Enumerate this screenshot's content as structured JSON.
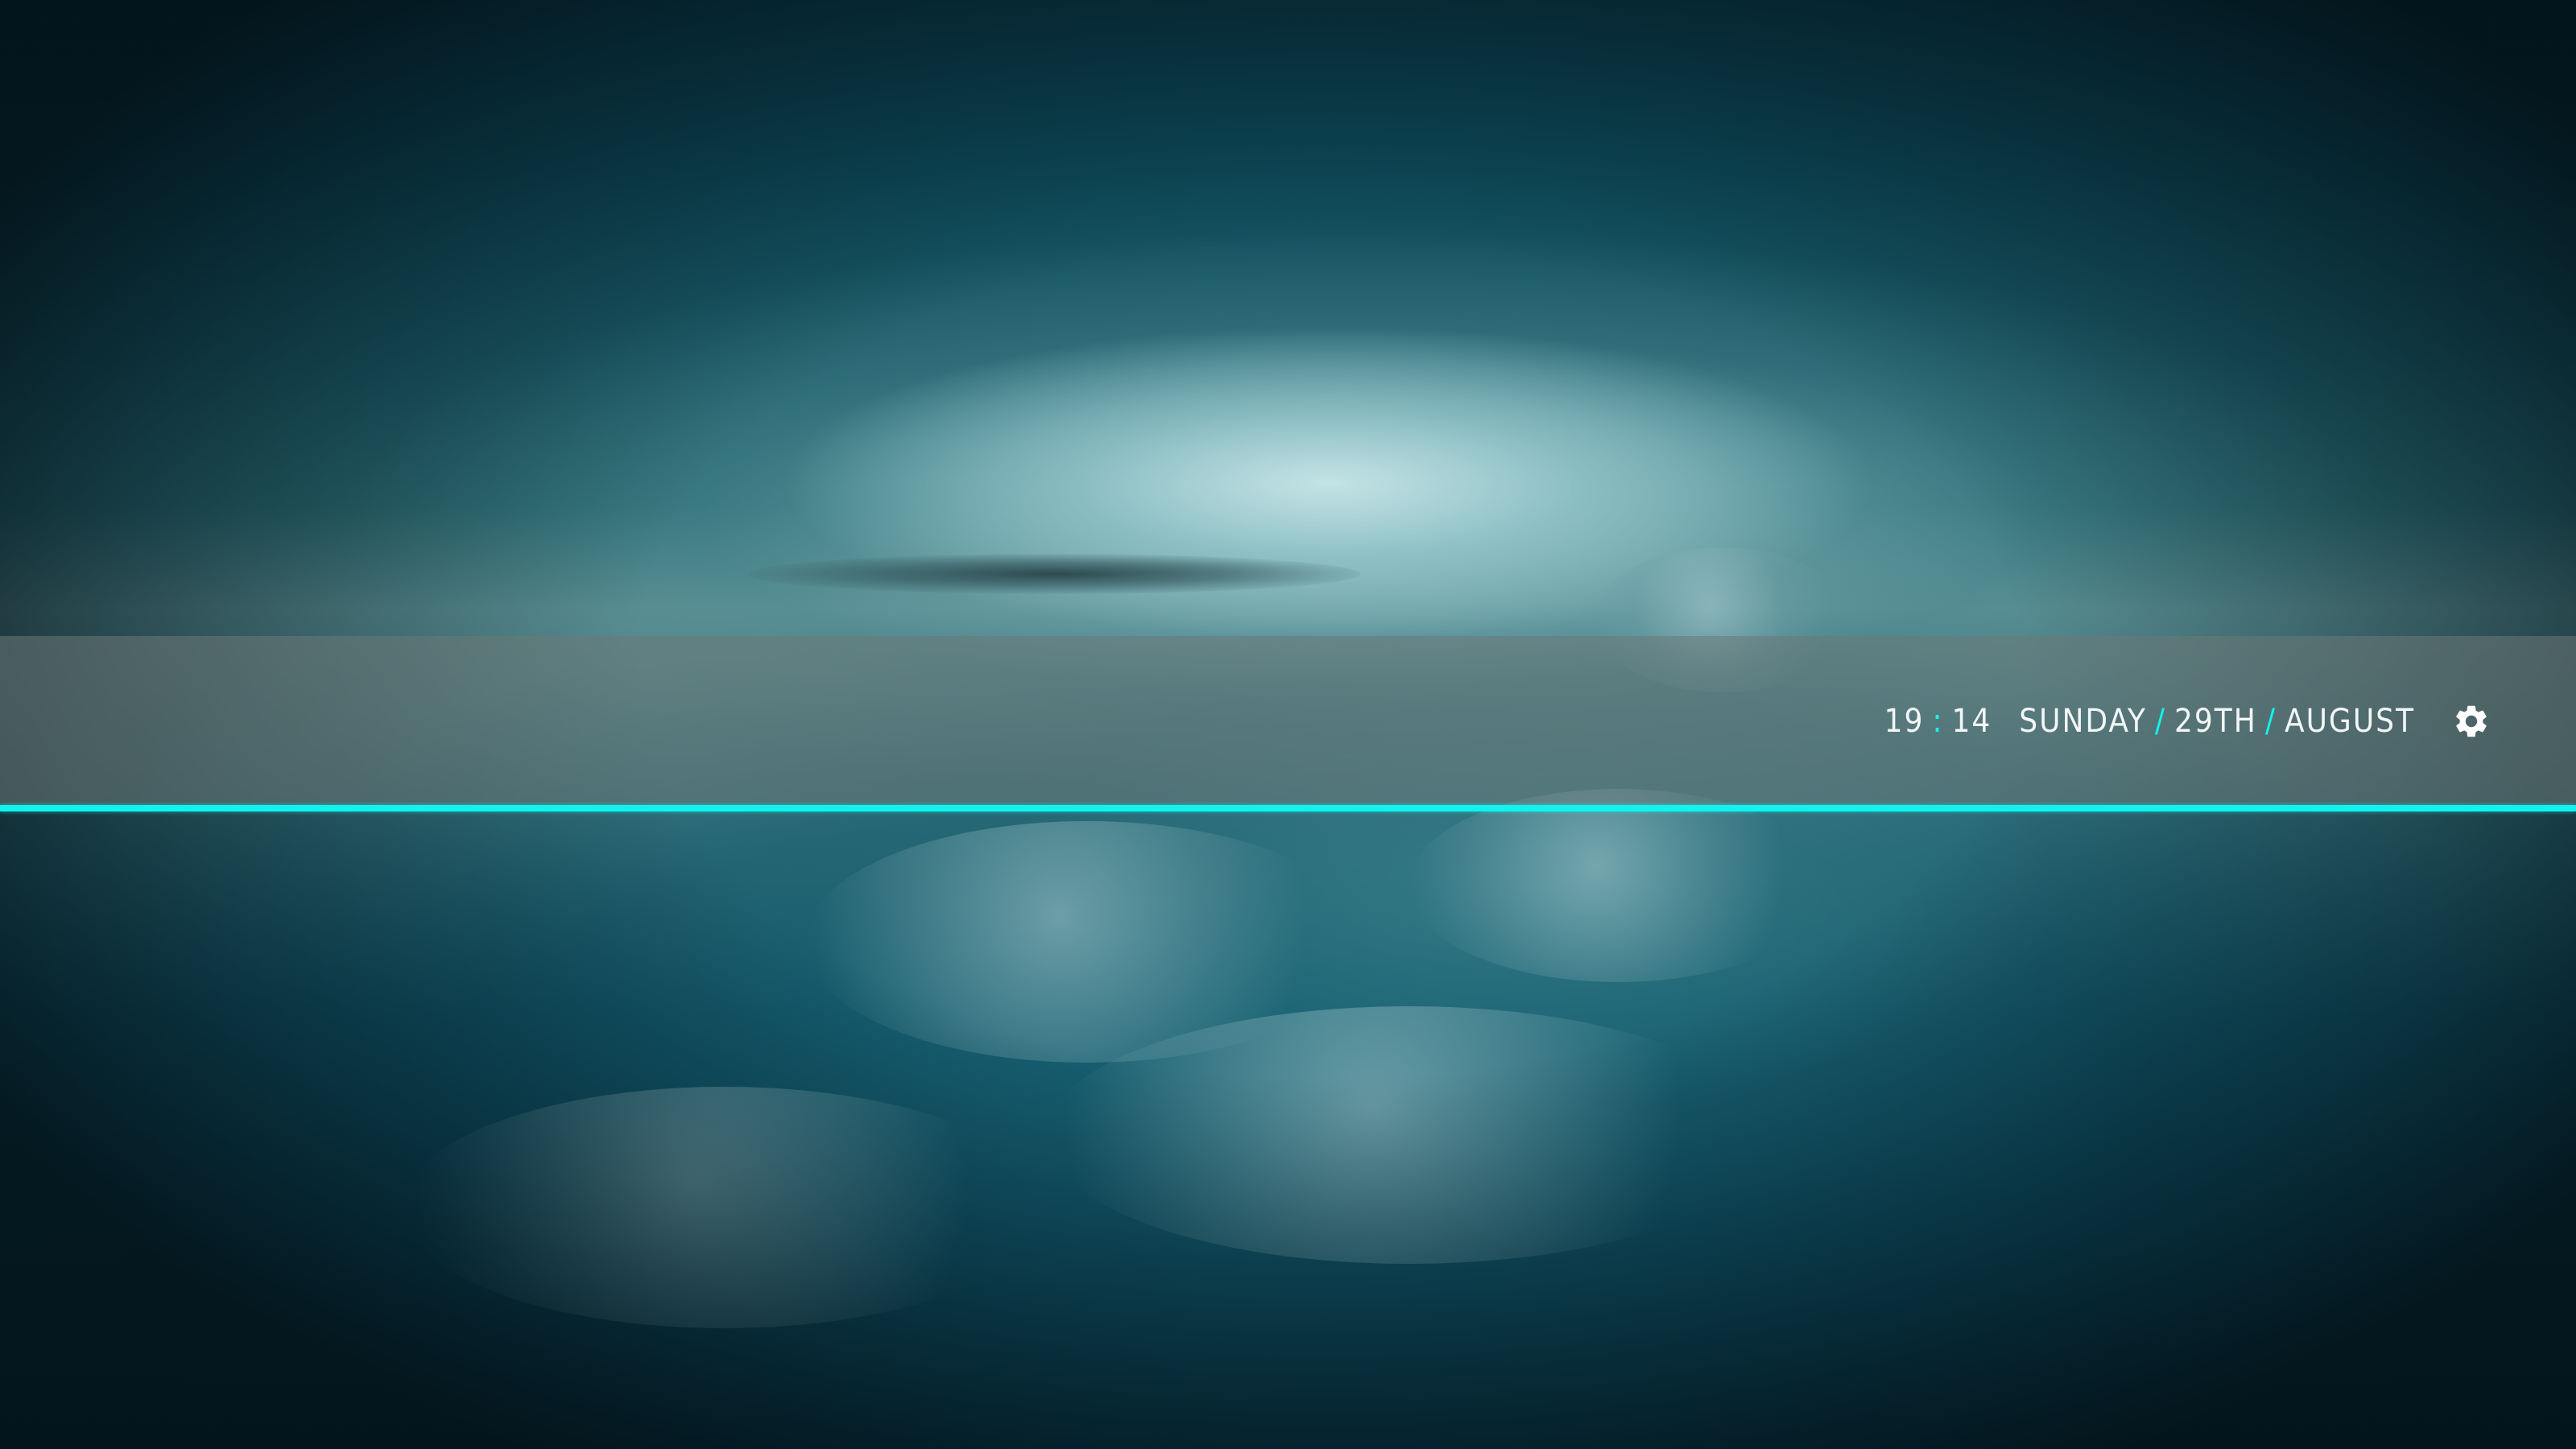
{
  "wallpaper": {
    "description_icon": "sky-clouds-wallpaper"
  },
  "theme": {
    "accent": "#12f3ef",
    "bar": "#6e7876",
    "text": "#f2f6f6"
  },
  "topbar": {
    "clock": {
      "hours": "19",
      "separator": ":",
      "minutes": "14"
    },
    "date": {
      "weekday": "Sunday",
      "day": "29th",
      "month": "August",
      "separator": "/"
    },
    "settings_icon": "gear-icon"
  }
}
